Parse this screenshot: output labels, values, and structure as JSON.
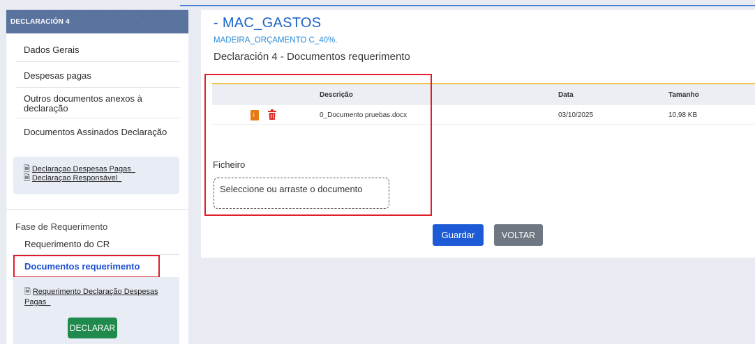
{
  "sidebar": {
    "header": "DECLARACIÓN 4",
    "items": [
      {
        "label": "Dados Gerais"
      },
      {
        "label": "Despesas pagas"
      },
      {
        "label": "Outros documentos anexos à declaração"
      },
      {
        "label": "Documentos Assinados Declaração"
      }
    ],
    "doc_links": [
      {
        "label": "Declaraçao Despesas Pagas_"
      },
      {
        "label": "Declaraçao Responsável_"
      }
    ],
    "fase": {
      "title": "Fase de Requerimento",
      "item_cr": "Requerimento do CR",
      "item_active": "Documentos requerimento",
      "req_link": "Requerimento Declaração Despesas Pagas_",
      "declarar": "DECLARAR"
    }
  },
  "main": {
    "project_title": "- MAC_GASTOS",
    "project_subtitle": "MADEIRA_ORÇAMENTO C_40%.",
    "page_title": "Declaración 4 - Documentos requerimento",
    "table": {
      "headers": {
        "descricao": "Descrição",
        "data": "Data",
        "tamanho": "Tamanho"
      },
      "rows": [
        {
          "descricao": "0_Documento pruebas.docx",
          "data": "03/10/2025",
          "tamanho": "10,98 KB"
        }
      ]
    },
    "ficheiro_label": "Ficheiro",
    "dropzone_text": "Seleccione ou arraste o documento",
    "guardar": "Guardar",
    "voltar": "VOLTAR"
  },
  "colors": {
    "accent_blue": "#1d5bd6",
    "sidebar_header": "#56709c",
    "highlight_red": "#e21d2a",
    "declarar_green": "#1f8a4c",
    "table_accent": "#f2c24a"
  },
  "icons": [
    "document-icon",
    "download-icon",
    "trash-icon"
  ]
}
